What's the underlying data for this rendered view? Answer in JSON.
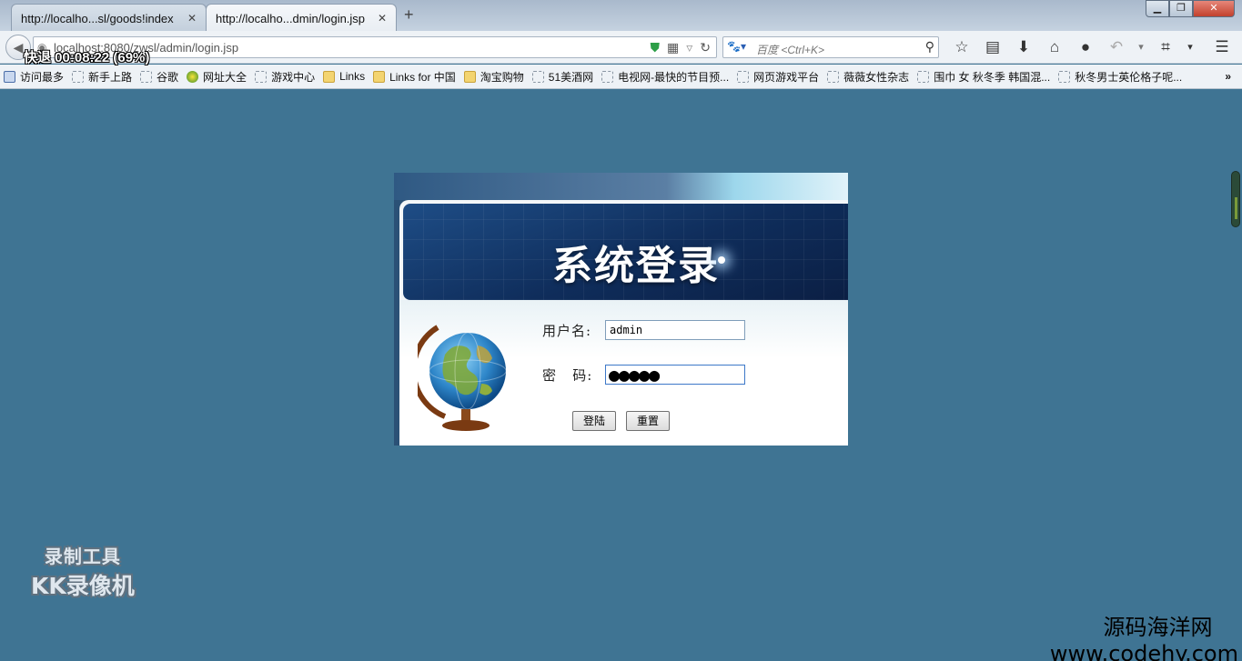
{
  "browser": {
    "tabs": [
      {
        "title": "http://localho...sl/goods!index",
        "active": false
      },
      {
        "title": "http://localho...dmin/login.jsp",
        "active": true
      }
    ],
    "url": "localhost:8080/zwsl/admin/login.jsp",
    "search_placeholder": "百度 <Ctrl+K>",
    "bookmarks": [
      "访问最多",
      "新手上路",
      "谷歌",
      "网址大全",
      "游戏中心",
      "Links",
      "Links for 中国",
      "淘宝购物",
      "51美酒网",
      "电视网-最快的节目预...",
      "网页游戏平台",
      "薇薇女性杂志",
      "围巾 女 秋冬季 韩国混...",
      "秋冬男士英伦格子呢..."
    ],
    "recorder_status": "快退 00:08:22 (69%)"
  },
  "login": {
    "title": "系统登录",
    "username_label": "用户名:",
    "username_value": "admin",
    "password_label": "密   码:",
    "password_value": "●●●●●",
    "login_button": "登陆",
    "reset_button": "重置"
  },
  "watermarks": {
    "recorder_line1": "录制工具",
    "recorder_line2": "KK录像机",
    "site_cn": "源码海洋网",
    "site_en": "www.codehy.com"
  },
  "colors": {
    "page_background": "#3f7493",
    "banner_dark": "#0f2d5b"
  }
}
